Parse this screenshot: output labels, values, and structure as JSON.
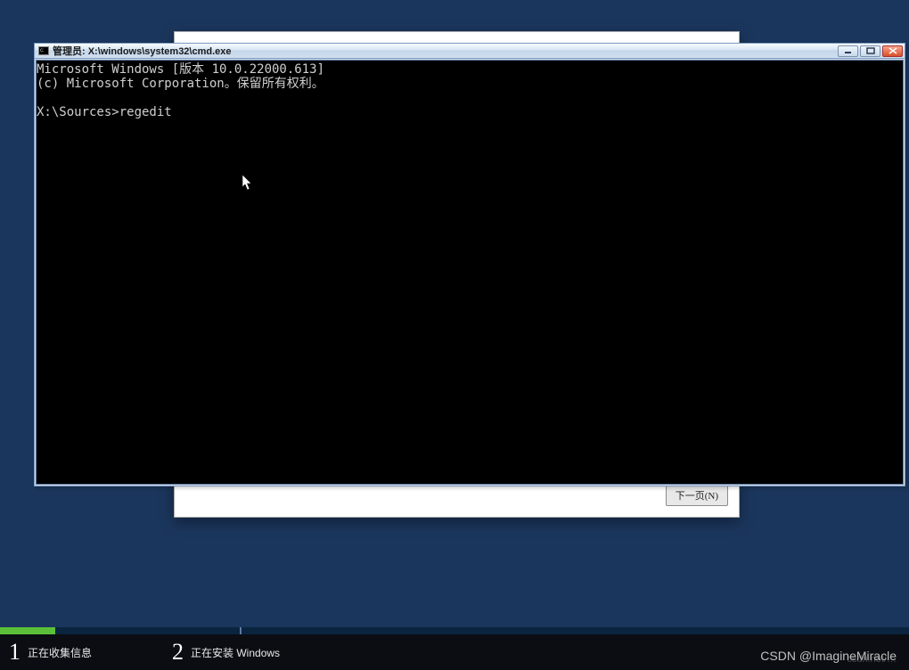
{
  "installer": {
    "next_label": "下一页(N)"
  },
  "steps": {
    "step1": {
      "num": "1",
      "label": "正在收集信息"
    },
    "step2": {
      "num": "2",
      "label": "正在安装 Windows"
    }
  },
  "cmd": {
    "title": "管理员: X:\\windows\\system32\\cmd.exe",
    "lines": {
      "l1": "Microsoft Windows [版本 10.0.22000.613]",
      "l2": "(c) Microsoft Corporation。保留所有权利。",
      "l3": "",
      "l4": "X:\\Sources>regedit"
    }
  },
  "watermark": "CSDN @ImagineMiracle",
  "watermark2": "csdn.net/…"
}
